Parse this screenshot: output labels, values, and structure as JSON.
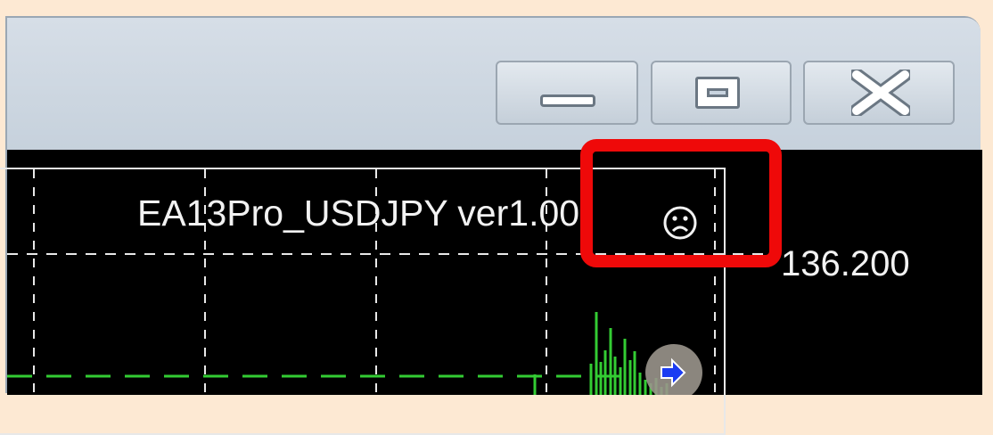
{
  "window": {
    "controls": {
      "minimize": "minimize",
      "maximize": "maximize",
      "close": "close"
    }
  },
  "chart": {
    "title": "EA13Pro_USDJPY ver1.00",
    "status_icon": "sad-face-icon",
    "price_label": "136.200",
    "trade_marker_icon": "blue-arrow-right-icon"
  },
  "colors": {
    "background": "#fde9d3",
    "chart_bg": "#000000",
    "grid": "#e8e8e8",
    "price_line": "#33cc33",
    "highlight": "#ef0909"
  }
}
